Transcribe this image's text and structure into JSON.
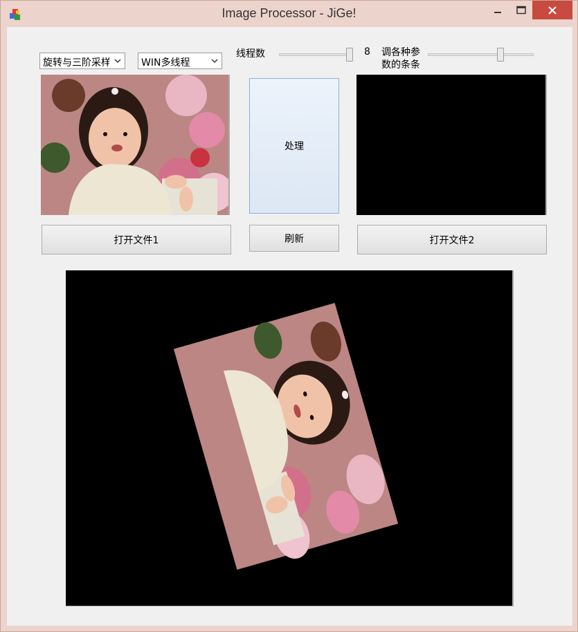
{
  "window": {
    "title": "Image Processor - JiGe!",
    "icon": "app-icon",
    "controls": [
      "minimize-icon",
      "maximize-icon",
      "close-icon"
    ],
    "accent": "#c74b3f"
  },
  "toolbar": {
    "algorithm_select": {
      "value": "旋转与三阶采样"
    },
    "thread_mode_select": {
      "value": "WIN多线程"
    },
    "thread_label": "线程数",
    "thread_count": "8",
    "thread_slider_level": 1.0,
    "param_label": "调各种参数的条条",
    "param_slider_level": 0.66
  },
  "panels": {
    "source1": {
      "content": "photo-girl"
    },
    "source2": {
      "content": "empty-black"
    },
    "result": {
      "content": "photo-girl-rotated-70deg"
    }
  },
  "buttons": {
    "process": "处理",
    "refresh": "刷新",
    "open1": "打开文件1",
    "open2": "打开文件2"
  }
}
